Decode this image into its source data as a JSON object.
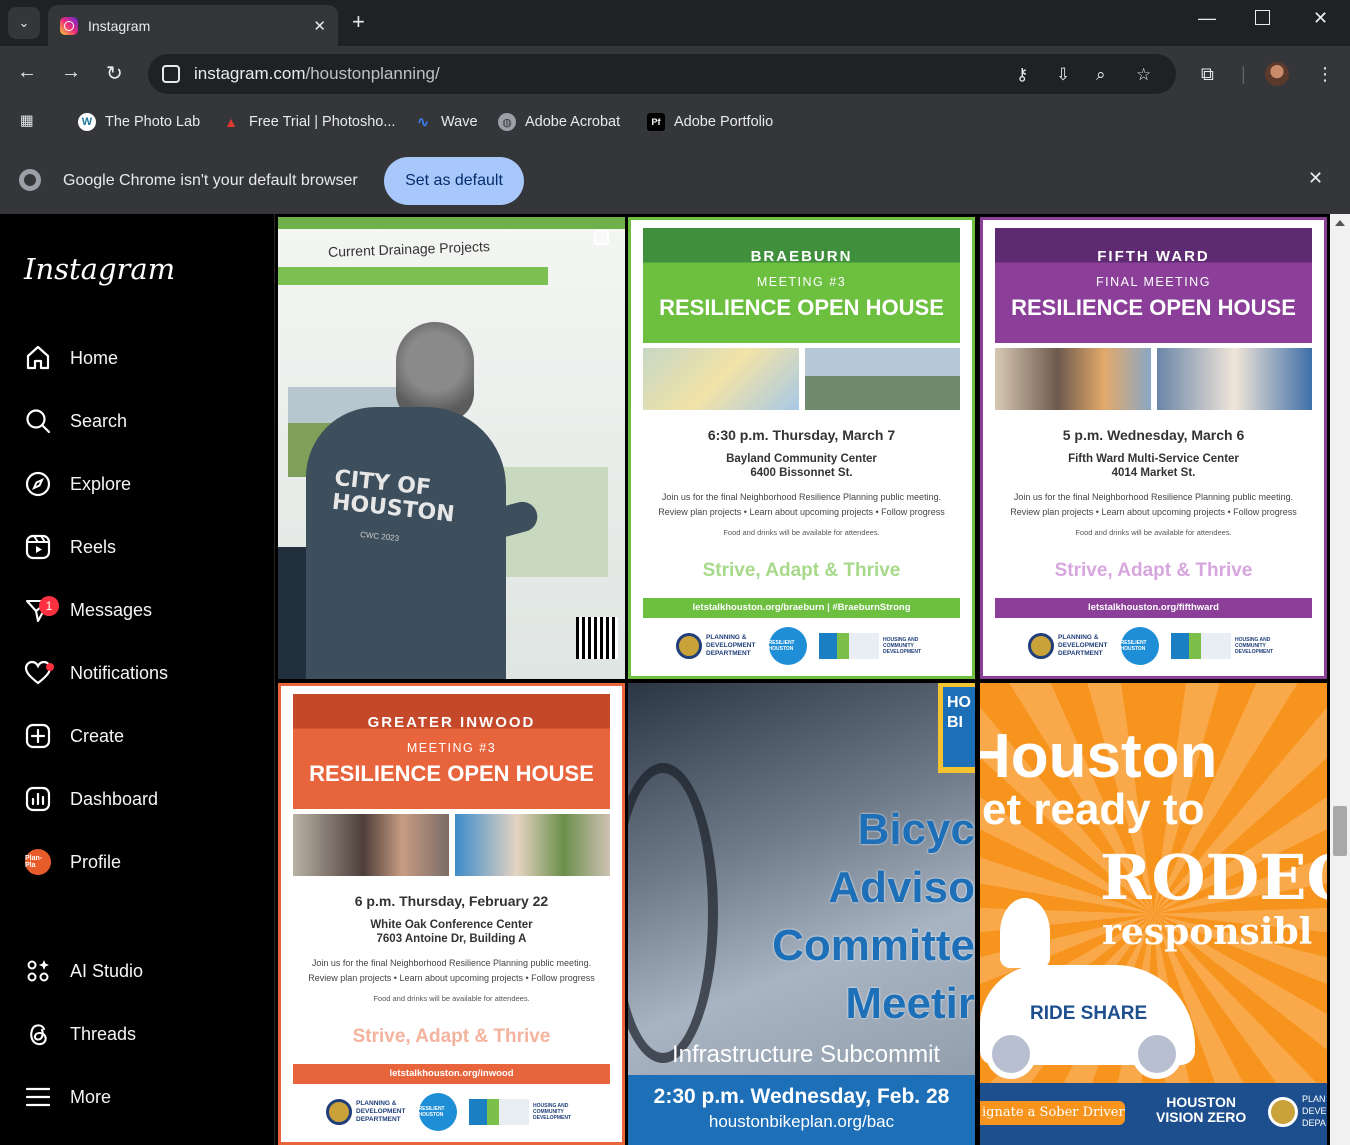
{
  "browser": {
    "tab_title": "Instagram",
    "url_host": "instagram.com",
    "url_path": "/houstonplanning/",
    "bookmarks": [
      "The Photo Lab",
      "Free Trial | Photosho...",
      "Wave",
      "Adobe Acrobat",
      "Adobe Portfolio"
    ],
    "infobar_message": "Google Chrome isn't your default browser",
    "infobar_button": "Set as default"
  },
  "sidebar": {
    "logo": "Instagram",
    "items": [
      {
        "label": "Home",
        "icon": "home-icon"
      },
      {
        "label": "Search",
        "icon": "search-icon"
      },
      {
        "label": "Explore",
        "icon": "compass-icon"
      },
      {
        "label": "Reels",
        "icon": "reels-icon"
      },
      {
        "label": "Messages",
        "icon": "messenger-icon",
        "badge": "1"
      },
      {
        "label": "Notifications",
        "icon": "heart-icon"
      },
      {
        "label": "Create",
        "icon": "plus-square-icon"
      },
      {
        "label": "Dashboard",
        "icon": "dashboard-icon"
      },
      {
        "label": "Profile",
        "icon": "profile-avatar"
      },
      {
        "label": "AI Studio",
        "icon": "ai-studio-icon"
      },
      {
        "label": "Threads",
        "icon": "threads-icon"
      },
      {
        "label": "More",
        "icon": "menu-icon"
      }
    ],
    "profile_avatar_text": "Plan-Pla"
  },
  "posts": {
    "photo": {
      "poster_heading": "Current Drainage Projects",
      "shirt_text": "CITY OF HOUSTON",
      "shirt_sub": "CWC 2023"
    },
    "braeburn": {
      "name": "BRAEBURN",
      "meeting": "MEETING #3",
      "title": "RESILIENCE OPEN HOUSE",
      "when": "6:30 p.m. Thursday, March 7",
      "venue": "Bayland Community Center",
      "address": "6400 Bissonnet St.",
      "body1": "Join us for the final Neighborhood Resilience Planning public meeting.",
      "body2": "Review plan projects • Learn about upcoming projects • Follow progress",
      "food": "Food and drinks will be available for attendees.",
      "tagline": "Strive, Adapt & Thrive",
      "url": "letstalkhouston.org/braeburn | #BraeburnStrong",
      "dept": "PLANNING & DEVELOPMENT DEPARTMENT",
      "resilient": "RESILIENT HOUSTON",
      "hcd": "HOUSING AND COMMUNITY DEVELOPMENT"
    },
    "fifthward": {
      "name": "FIFTH WARD",
      "meeting": "FINAL MEETING",
      "title": "RESILIENCE OPEN HOUSE",
      "when": "5 p.m. Wednesday, March 6",
      "venue": "Fifth Ward Multi-Service Center",
      "address": "4014 Market St.",
      "body1": "Join us for the final Neighborhood Resilience Planning public meeting.",
      "body2": "Review plan projects • Learn about upcoming projects • Follow progress",
      "food": "Food and drinks will be available for attendees.",
      "tagline": "Strive, Adapt & Thrive",
      "url": "letstalkhouston.org/fifthward",
      "dept": "PLANNING & DEVELOPMENT DEPARTMENT",
      "resilient": "RESILIENT HOUSTON",
      "hcd": "HOUSING AND COMMUNITY DEVELOPMENT"
    },
    "inwood": {
      "name": "GREATER INWOOD",
      "meeting": "MEETING #3",
      "title": "RESILIENCE OPEN HOUSE",
      "when": "6 p.m. Thursday, February 22",
      "venue": "White Oak Conference Center",
      "address": "7603 Antoine Dr, Building A",
      "body1": "Join us for the final Neighborhood Resilience Planning public meeting.",
      "body2": "Review plan projects • Learn about upcoming projects • Follow progress",
      "food": "Food and drinks will be available for attendees.",
      "tagline": "Strive, Adapt & Thrive",
      "url": "letstalkhouston.org/inwood",
      "dept": "PLANNING & DEVELOPMENT DEPARTMENT",
      "resilient": "RESILIENT HOUSTON",
      "hcd": "HOUSING AND COMMUNITY DEVELOPMENT"
    },
    "bike": {
      "line1": "Bicyc",
      "line2": "Adviso",
      "line3": "Committe",
      "line4": "Meetir",
      "sub": "Infrastructure Subcommit",
      "when": "2:30 p.m. Wednesday, Feb. 28",
      "url": "houstonbikeplan.org/bac",
      "corner": "HO BI"
    },
    "rodeo": {
      "line1": "Houston",
      "line2": "et ready to",
      "line3": "RODEO",
      "line4": "responsibl",
      "car": "RIDE SHARE",
      "cta": "ignate a Sober Driver",
      "vz1": "HOUSTON",
      "vz2": "VISION ZERO",
      "dept": "PLAN DEVE DEPA"
    }
  },
  "colors": {
    "braeburn": "#6cbf3f",
    "fifthward": "#8b3f99",
    "inwood": "#e8643c",
    "rodeo": "#f7941d",
    "bike_blue": "#1d6fb8"
  }
}
